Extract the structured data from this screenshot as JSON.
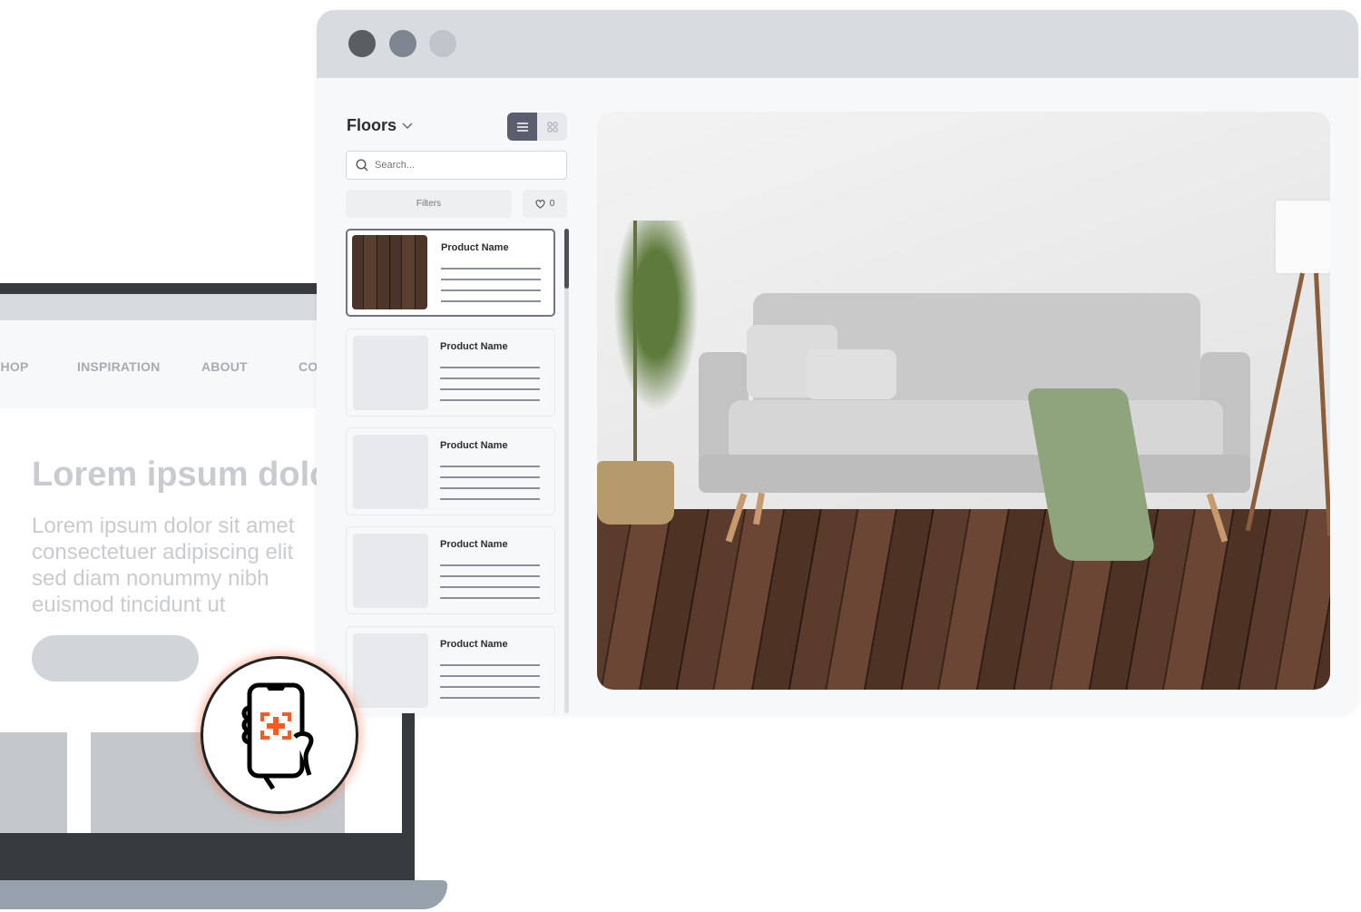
{
  "laptop": {
    "nav": [
      "SHOP",
      "INSPIRATION",
      "ABOUT",
      "CO"
    ],
    "hero_title": "Lorem ipsum dolo",
    "hero_text": "Lorem ipsum dolor sit amet\nconsectetuer adipiscing elit\nsed diam nonummy nibh\neuismod tincidunt ut"
  },
  "badge": {
    "icon": "phone-ar-scan-icon",
    "accent": "#ff5a1f"
  },
  "browser": {
    "window_dots": [
      "#5a5d61",
      "#7d8591",
      "#c0c5cc"
    ],
    "panel": {
      "title": "Floors",
      "search_placeholder": "Search...",
      "filters_label": "Filters",
      "favorites_count": "0",
      "products": [
        {
          "name": "Product Name",
          "selected": true
        },
        {
          "name": "Product Name",
          "selected": false
        },
        {
          "name": "Product Name",
          "selected": false
        },
        {
          "name": "Product Name",
          "selected": false
        },
        {
          "name": "Product Name",
          "selected": false
        }
      ]
    }
  }
}
